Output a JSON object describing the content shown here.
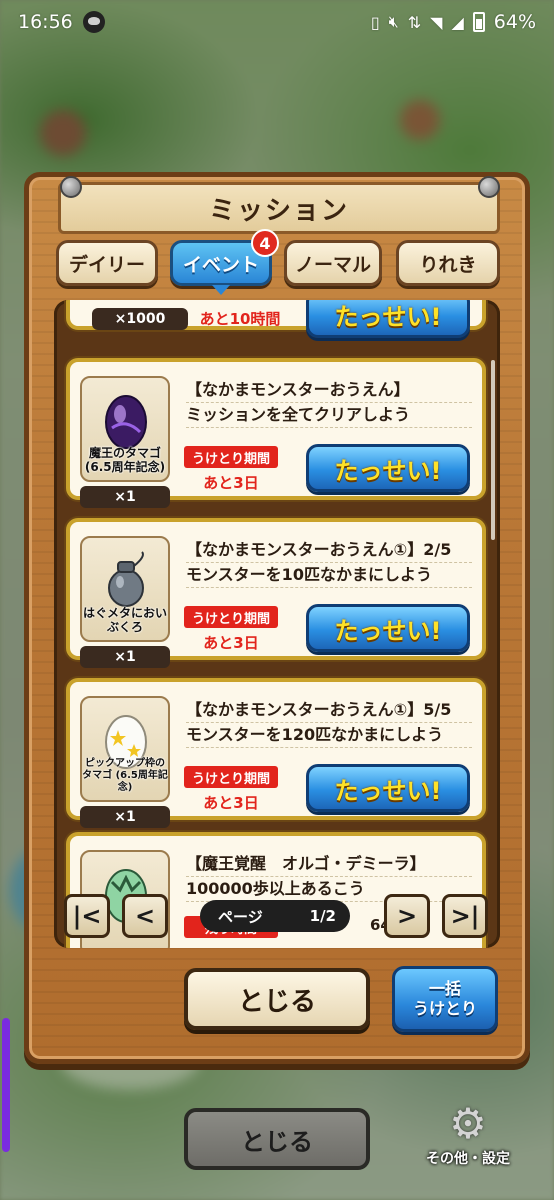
{
  "status_bar": {
    "time": "16:56",
    "battery": "64%"
  },
  "dialog": {
    "title": "ミッション",
    "tabs": [
      {
        "label": "デイリー",
        "active": false
      },
      {
        "label": "イベント",
        "active": true,
        "badge": "4"
      },
      {
        "label": "ノーマル",
        "active": false
      },
      {
        "label": "りれき",
        "active": false
      }
    ],
    "top_partial": {
      "quantity": "×1000",
      "remaining": "あと10時間",
      "button": "たっせい!"
    },
    "missions": [
      {
        "item_name": "魔王のタマゴ (6.5周年記念)",
        "quantity": "×1",
        "title": "【なかまモンスターおうえん】",
        "detail": "ミッションを全てクリアしよう",
        "period_label": "うけとり期間",
        "remaining": "あと3日",
        "button": "たっせい!"
      },
      {
        "item_name": "はぐメタにおいぶくろ",
        "quantity": "×1",
        "title": "【なかまモンスターおうえん①】2/5",
        "detail": "モンスターを10匹なかまにしよう",
        "period_label": "うけとり期間",
        "remaining": "あと3日",
        "button": "たっせい!"
      },
      {
        "item_name": "ピックアップ枠のタマゴ (6.5周年記念)",
        "quantity": "×1",
        "title": "【なかまモンスターおうえん①】5/5",
        "detail": "モンスターを120匹なかまにしよう",
        "period_label": "うけとり期間",
        "remaining": "あと3日",
        "button": "たっせい!"
      }
    ],
    "bottom_partial": {
      "title": "【魔王覚醒　オルゴ・デミーラ】",
      "detail": "100000歩以上あるこう",
      "period_label": "残り時間",
      "count": "64"
    },
    "pager": {
      "first": "|<",
      "prev": "<",
      "next": ">",
      "last": ">|",
      "label": "ページ",
      "value": "1/2"
    },
    "close_label": "とじる",
    "bulk_label_1": "一括",
    "bulk_label_2": "うけとり"
  },
  "underlying": {
    "close_label": "とじる",
    "settings_label": "その他・設定"
  },
  "colors": {
    "accent_blue": "#2a87db",
    "badge_red": "#e02a1f",
    "achieve_text": "#ffe227",
    "card_border": "#c9a22c"
  }
}
